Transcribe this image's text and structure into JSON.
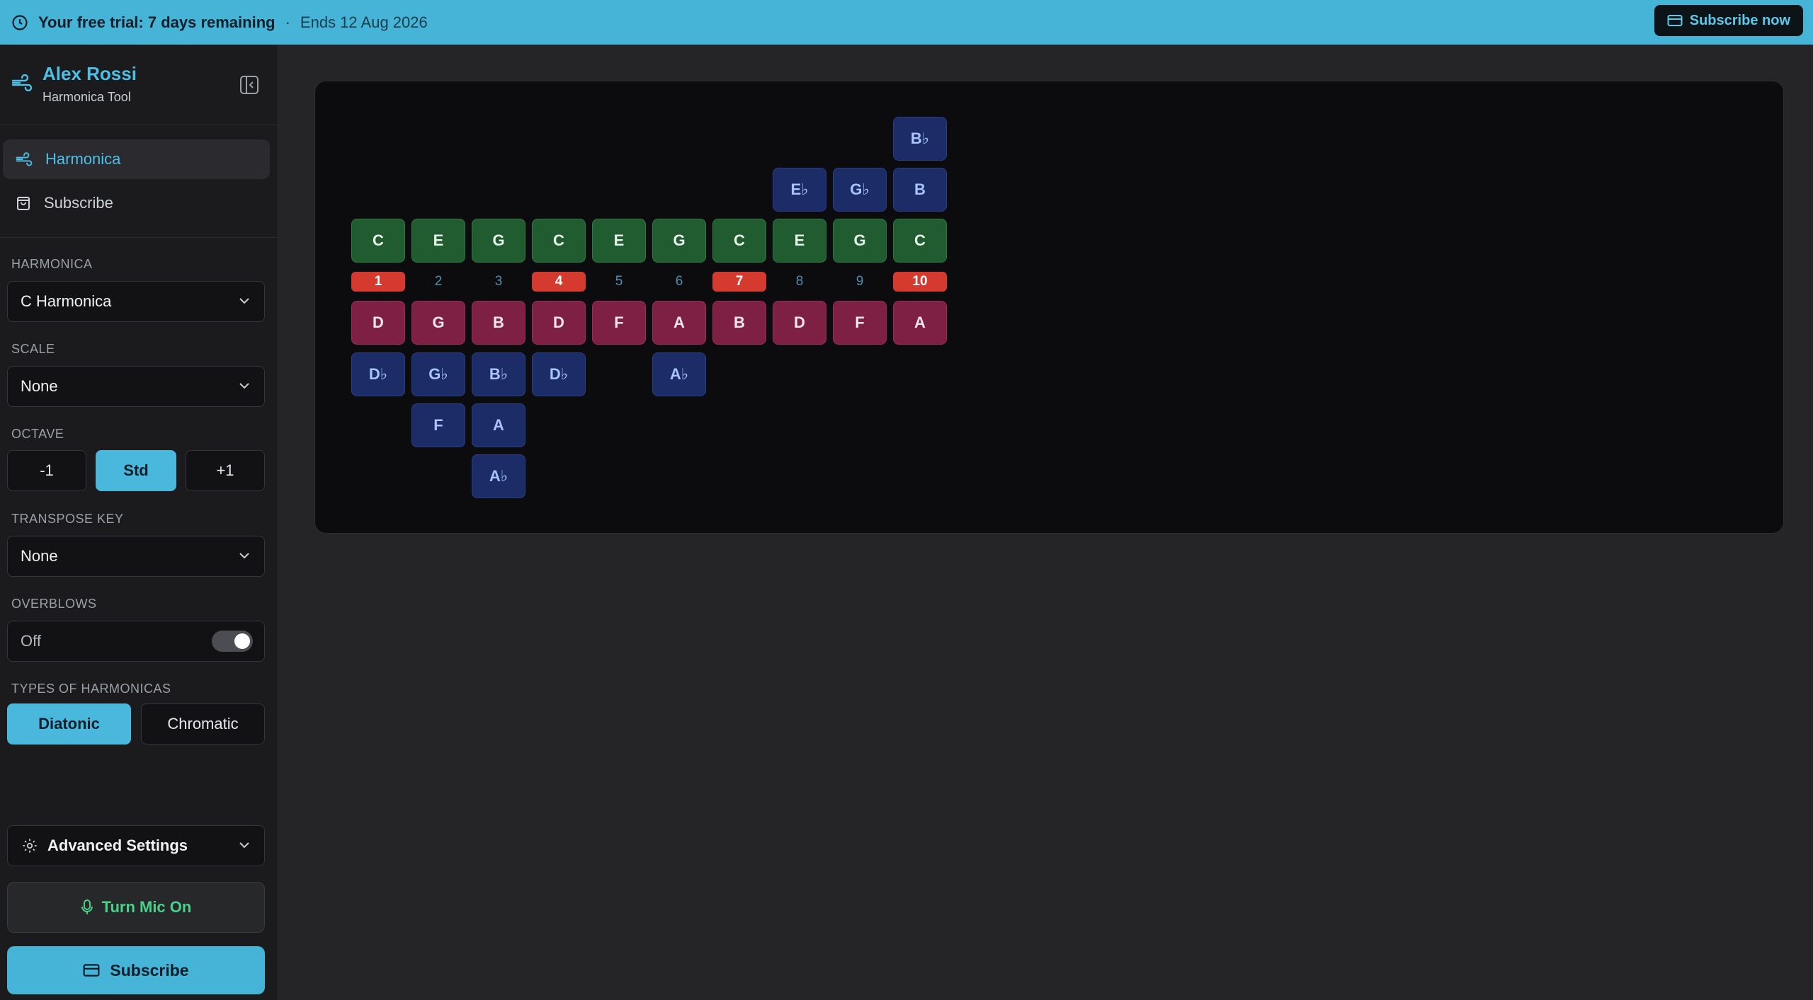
{
  "banner": {
    "trial_text": "Your free trial: 7 days remaining",
    "separator": "·",
    "ends_text": "Ends 12 Aug 2026",
    "subscribe_label": "Subscribe now"
  },
  "sidebar": {
    "user_name": "Alex Rossi",
    "tagline": "Harmonica Tool",
    "nav": [
      {
        "label": "Harmonica",
        "icon": "wind-icon",
        "active": true
      },
      {
        "label": "Subscribe",
        "icon": "shopping-bag-icon",
        "active": false
      }
    ],
    "harmonica": {
      "label": "HARMONICA",
      "value": "C Harmonica"
    },
    "scale": {
      "label": "SCALE",
      "value": "None"
    },
    "octave": {
      "label": "OCTAVE",
      "options": [
        "-1",
        "Std",
        "+1"
      ],
      "selected": "Std"
    },
    "transpose": {
      "label": "TRANSPOSE KEY",
      "value": "None"
    },
    "overblows": {
      "label": "OVERBLOWS",
      "value": "Off"
    },
    "types": {
      "label": "TYPES OF HARMONICAS",
      "options": [
        "Diatonic",
        "Chromatic"
      ],
      "selected": "Diatonic"
    },
    "advanced_label": "Advanced Settings",
    "mic_label": "Turn Mic On",
    "subscribe_label": "Subscribe"
  },
  "colors": {
    "accent": "#46b4d6",
    "blow": "#205c30",
    "draw": "#7e2043",
    "bend": "#1b2c66",
    "hole_highlight": "#d43a2e"
  },
  "harmonica": {
    "holes": [
      "1",
      "2",
      "3",
      "4",
      "5",
      "6",
      "7",
      "8",
      "9",
      "10"
    ],
    "highlighted_holes": [
      "1",
      "4",
      "7",
      "10"
    ],
    "blow_bends": [
      [
        "",
        "",
        "",
        "",
        "",
        "",
        "",
        "",
        "",
        "Bb"
      ],
      [
        "",
        "",
        "",
        "",
        "",
        "",
        "",
        "Eb",
        "Gb",
        "B"
      ]
    ],
    "blow": [
      "C",
      "E",
      "G",
      "C",
      "E",
      "G",
      "C",
      "E",
      "G",
      "C"
    ],
    "draw": [
      "D",
      "G",
      "B",
      "D",
      "F",
      "A",
      "B",
      "D",
      "F",
      "A"
    ],
    "draw_bends": [
      [
        "Db",
        "Gb",
        "Bb",
        "Db",
        "",
        "Ab",
        "",
        "",
        "",
        ""
      ],
      [
        "",
        "F",
        "A",
        "",
        "",
        "",
        "",
        "",
        "",
        ""
      ],
      [
        "",
        "",
        "Ab",
        "",
        "",
        "",
        "",
        "",
        "",
        ""
      ]
    ]
  }
}
